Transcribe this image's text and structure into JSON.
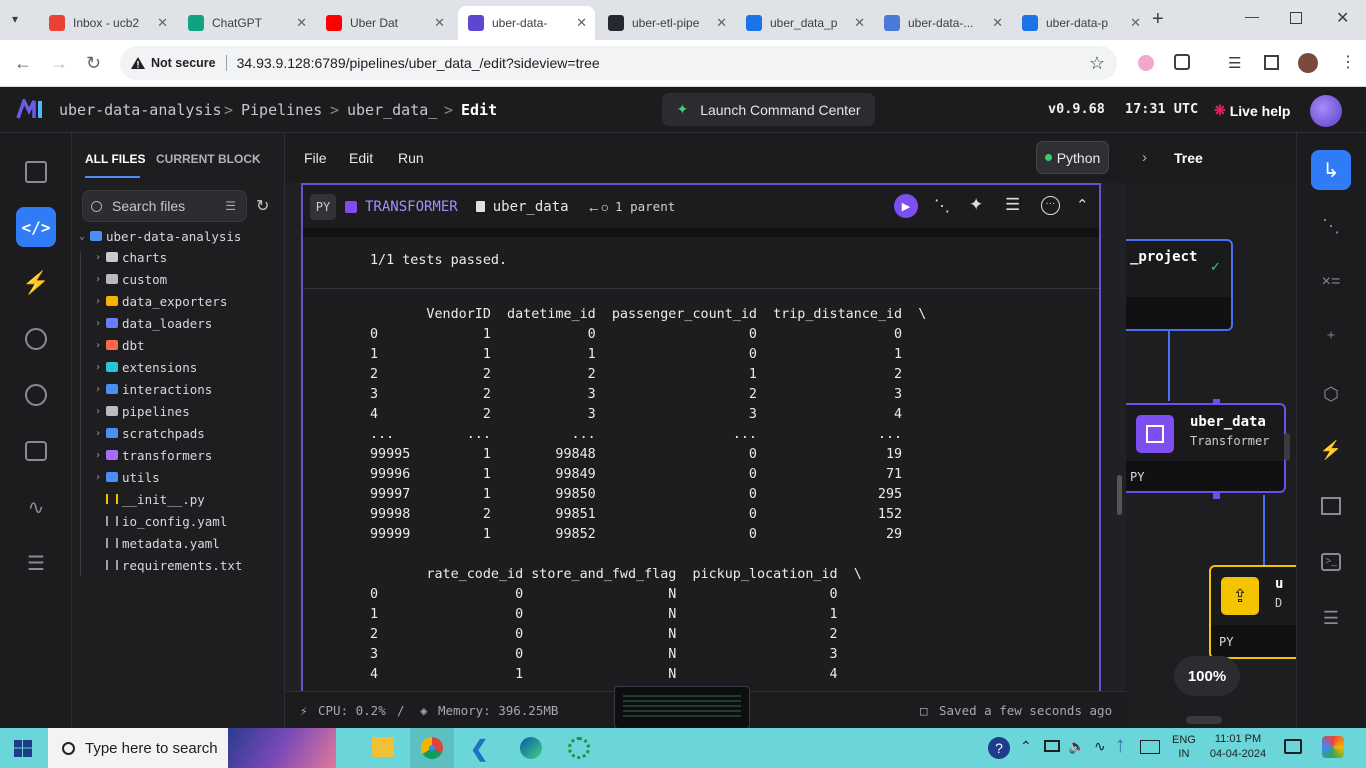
{
  "browser": {
    "tabs": [
      {
        "title": "Inbox - ucb2",
        "favicon": "gmail-icon",
        "color": "#ea4335"
      },
      {
        "title": "ChatGPT",
        "favicon": "chatgpt-icon",
        "color": "#10a37f"
      },
      {
        "title": "Uber Dat",
        "favicon": "youtube-icon",
        "color": "#ff0000"
      },
      {
        "title": "uber-data-",
        "favicon": "mage-icon",
        "color": "#5b47d1"
      },
      {
        "title": "uber-etl-pipe",
        "favicon": "github-icon",
        "color": "#24292f"
      },
      {
        "title": "uber_data_p",
        "favicon": "search-icon",
        "color": "#1a73e8"
      },
      {
        "title": "uber-data-...",
        "favicon": "diagram-icon",
        "color": "#4a7bd6"
      },
      {
        "title": "uber-data-p",
        "favicon": "shield-icon",
        "color": "#1a73e8"
      }
    ],
    "security": "Not secure",
    "url": "34.93.9.128:6789/pipelines/uber_data_/edit?sideview=tree"
  },
  "header": {
    "project": "uber-data-analysis",
    "sep": ">",
    "pipelines": "Pipelines",
    "pipeline": "uber_data_",
    "page": "Edit",
    "launch": "Launch Command Center",
    "version": "v0.9.68",
    "time": "17:31 UTC",
    "help": "Live help"
  },
  "files": {
    "tab_all": "ALL FILES",
    "tab_current": "CURRENT BLOCK",
    "search_placeholder": "Search files",
    "root": "uber-data-analysis",
    "items": [
      {
        "name": "charts",
        "icon": "chart-icon",
        "color": "#c9c9cf"
      },
      {
        "name": "custom",
        "icon": "custom-icon",
        "color": "#b8b8be"
      },
      {
        "name": "data_exporters",
        "icon": "exporter-icon",
        "color": "#f5b400"
      },
      {
        "name": "data_loaders",
        "icon": "loader-icon",
        "color": "#6a7cff"
      },
      {
        "name": "dbt",
        "icon": "dbt-icon",
        "color": "#ff694b"
      },
      {
        "name": "extensions",
        "icon": "extensions-icon",
        "color": "#27c5d8"
      },
      {
        "name": "interactions",
        "icon": "folder-icon",
        "color": "#4c8df6"
      },
      {
        "name": "pipelines",
        "icon": "pipeline-icon",
        "color": "#bbbbc1"
      },
      {
        "name": "scratchpads",
        "icon": "folder-icon",
        "color": "#4c8df6"
      },
      {
        "name": "transformers",
        "icon": "transformer-icon",
        "color": "#a66bff"
      },
      {
        "name": "utils",
        "icon": "folder-icon",
        "color": "#4c8df6"
      }
    ],
    "root_files": [
      {
        "name": "__init__.py",
        "icon": "python-icon",
        "color": "#f5c400"
      },
      {
        "name": "io_config.yaml",
        "icon": "yaml-icon",
        "color": "#9aa0a6"
      },
      {
        "name": "metadata.yaml",
        "icon": "yaml-icon",
        "color": "#9aa0a6"
      },
      {
        "name": "requirements.txt",
        "icon": "text-icon",
        "color": "#9aa0a6"
      }
    ]
  },
  "editor": {
    "menu": [
      "File",
      "Edit",
      "Run"
    ],
    "language": "Python",
    "block": {
      "lang": "PY",
      "type": "TRANSFORMER",
      "name": "uber_data",
      "parents": "1 parent"
    },
    "output": {
      "tests": "1/1 tests passed.",
      "lines": [
        "       VendorID  datetime_id  passenger_count_id  trip_distance_id  \\",
        "0             1            0                   0                 0",
        "1             1            1                   0                 1",
        "2             2            2                   1                 2",
        "3             2            3                   2                 3",
        "4             2            3                   3                 4",
        "...         ...          ...                 ...               ...",
        "99995         1        99848                   0                19",
        "99996         1        99849                   0                71",
        "99997         1        99850                   0               295",
        "99998         2        99851                   0               152",
        "99999         1        99852                   0                29",
        "",
        "       rate_code_id store_and_fwd_flag  pickup_location_id  \\",
        "0                 0                  N                   0",
        "1                 0                  N                   1",
        "2                 0                  N                   2",
        "3                 0                  N                   3",
        "4                 1                  N                   4"
      ]
    },
    "status": {
      "cpu": "CPU: 0.2%",
      "divider": "/",
      "memory": "Memory: 396.25MB",
      "saved": "Saved a few seconds ago"
    }
  },
  "tree": {
    "label": "Tree",
    "node1_title": "_project",
    "node2_title": "uber_data",
    "node2_sub": "Transformer",
    "node2_lang": "PY",
    "node3_title": "u",
    "node3_sub": "D",
    "node3_lang": "PY",
    "zoom": "100%"
  },
  "taskbar": {
    "search_placeholder": "Type here to search",
    "lang1": "ENG",
    "lang2": "IN",
    "time": "11:01 PM",
    "date": "04-04-2024"
  }
}
